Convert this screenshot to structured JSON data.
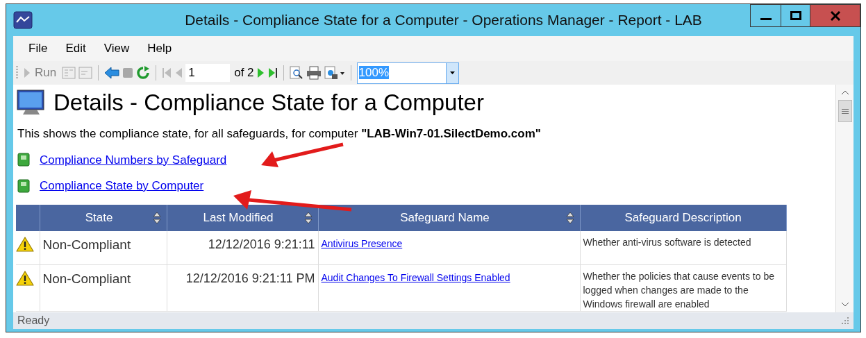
{
  "window": {
    "title": "Details - Compliance State for a Computer - Operations Manager - Report - LAB"
  },
  "menu": [
    "File",
    "Edit",
    "View",
    "Help"
  ],
  "toolbar": {
    "run": "Run",
    "page": "1",
    "page_count": "of 2",
    "zoom": "100%"
  },
  "report": {
    "title": "Details - Compliance State for a Computer",
    "description": "This shows the compliance state, for all safeguards, for computer **\"LAB-Win7-01.SilectDemo.com\"**",
    "links": [
      "Compliance Numbers by Safeguard",
      "Compliance State by Computer"
    ]
  },
  "table": {
    "columns": [
      {
        "label": "State",
        "sortable": true
      },
      {
        "label": "Last Modified",
        "sortable": true
      },
      {
        "label": "Safeguard Name",
        "sortable": true
      },
      {
        "label": "Safeguard Description",
        "sortable": false
      }
    ],
    "rows": [
      {
        "kind": "warning",
        "state": "Non-Compliant",
        "last_modified": "12/12/2016 9:21:11",
        "safeguard_name": "Antivirus Presence",
        "description": "Whether anti-virus software is detected"
      },
      {
        "kind": "warning",
        "state": "Non-Compliant",
        "last_modified": "12/12/2016 9:21:11 PM",
        "safeguard_name": "Audit Changes To Firewall Settings Enabled",
        "description": "Whether the policies that cause events to be logged when changes are made to the Windows firewall are enabled"
      }
    ]
  },
  "status_bar": "Ready"
}
